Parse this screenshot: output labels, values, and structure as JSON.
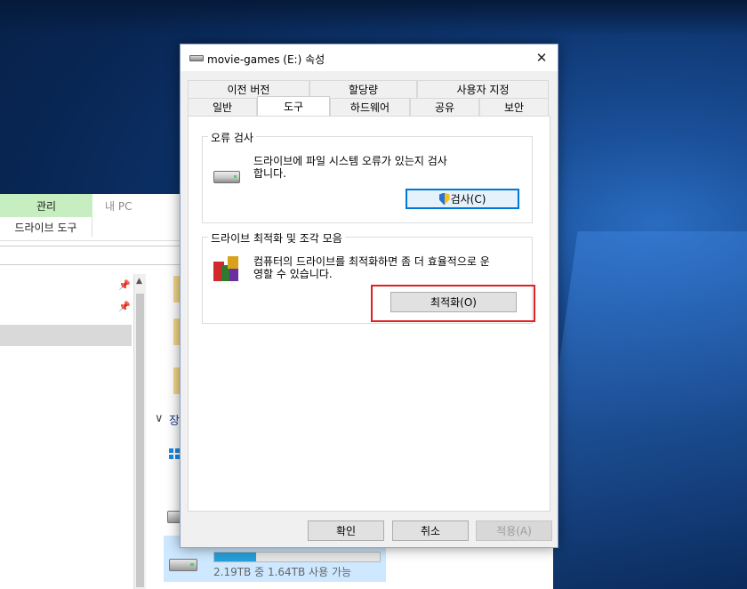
{
  "explorer": {
    "ribbon_tab_manage": "관리",
    "ribbon_tab_pc": "내 PC",
    "ribbon_sub_label": "드라이브 도구",
    "group_label": "장",
    "drive_caption": "2.19TB 중 1.64TB 사용 가능",
    "drive_usage_fraction": 0.25,
    "colors": {
      "manage_tab": "#c7eec0",
      "selection": "#cde8ff",
      "usage_bar": "#26a0da"
    }
  },
  "dialog": {
    "title": "movie-games (E:) 속성",
    "close_label": "✕",
    "tabs_row1": [
      "이전 버전",
      "할당량",
      "사용자 지정"
    ],
    "tabs_row2": [
      "일반",
      "도구",
      "하드웨어",
      "공유",
      "보안"
    ],
    "active_tab": "도구",
    "error_check": {
      "legend": "오류 검사",
      "description": "드라이브에 파일 시스템 오류가 있는지 검사\n합니다.",
      "button_label": "검사(C)"
    },
    "optimize": {
      "legend": "드라이브 최적화 및 조각 모음",
      "description": "컴퓨터의 드라이브를 최적화하면 좀 더 효율적으로 운\n영할 수 있습니다.",
      "button_label": "최적화(O)"
    },
    "footer": {
      "ok_label": "확인",
      "cancel_label": "취소",
      "apply_label": "적용(A)"
    },
    "colors": {
      "highlight": "#e01f1f",
      "focus": "#0078d7"
    }
  }
}
